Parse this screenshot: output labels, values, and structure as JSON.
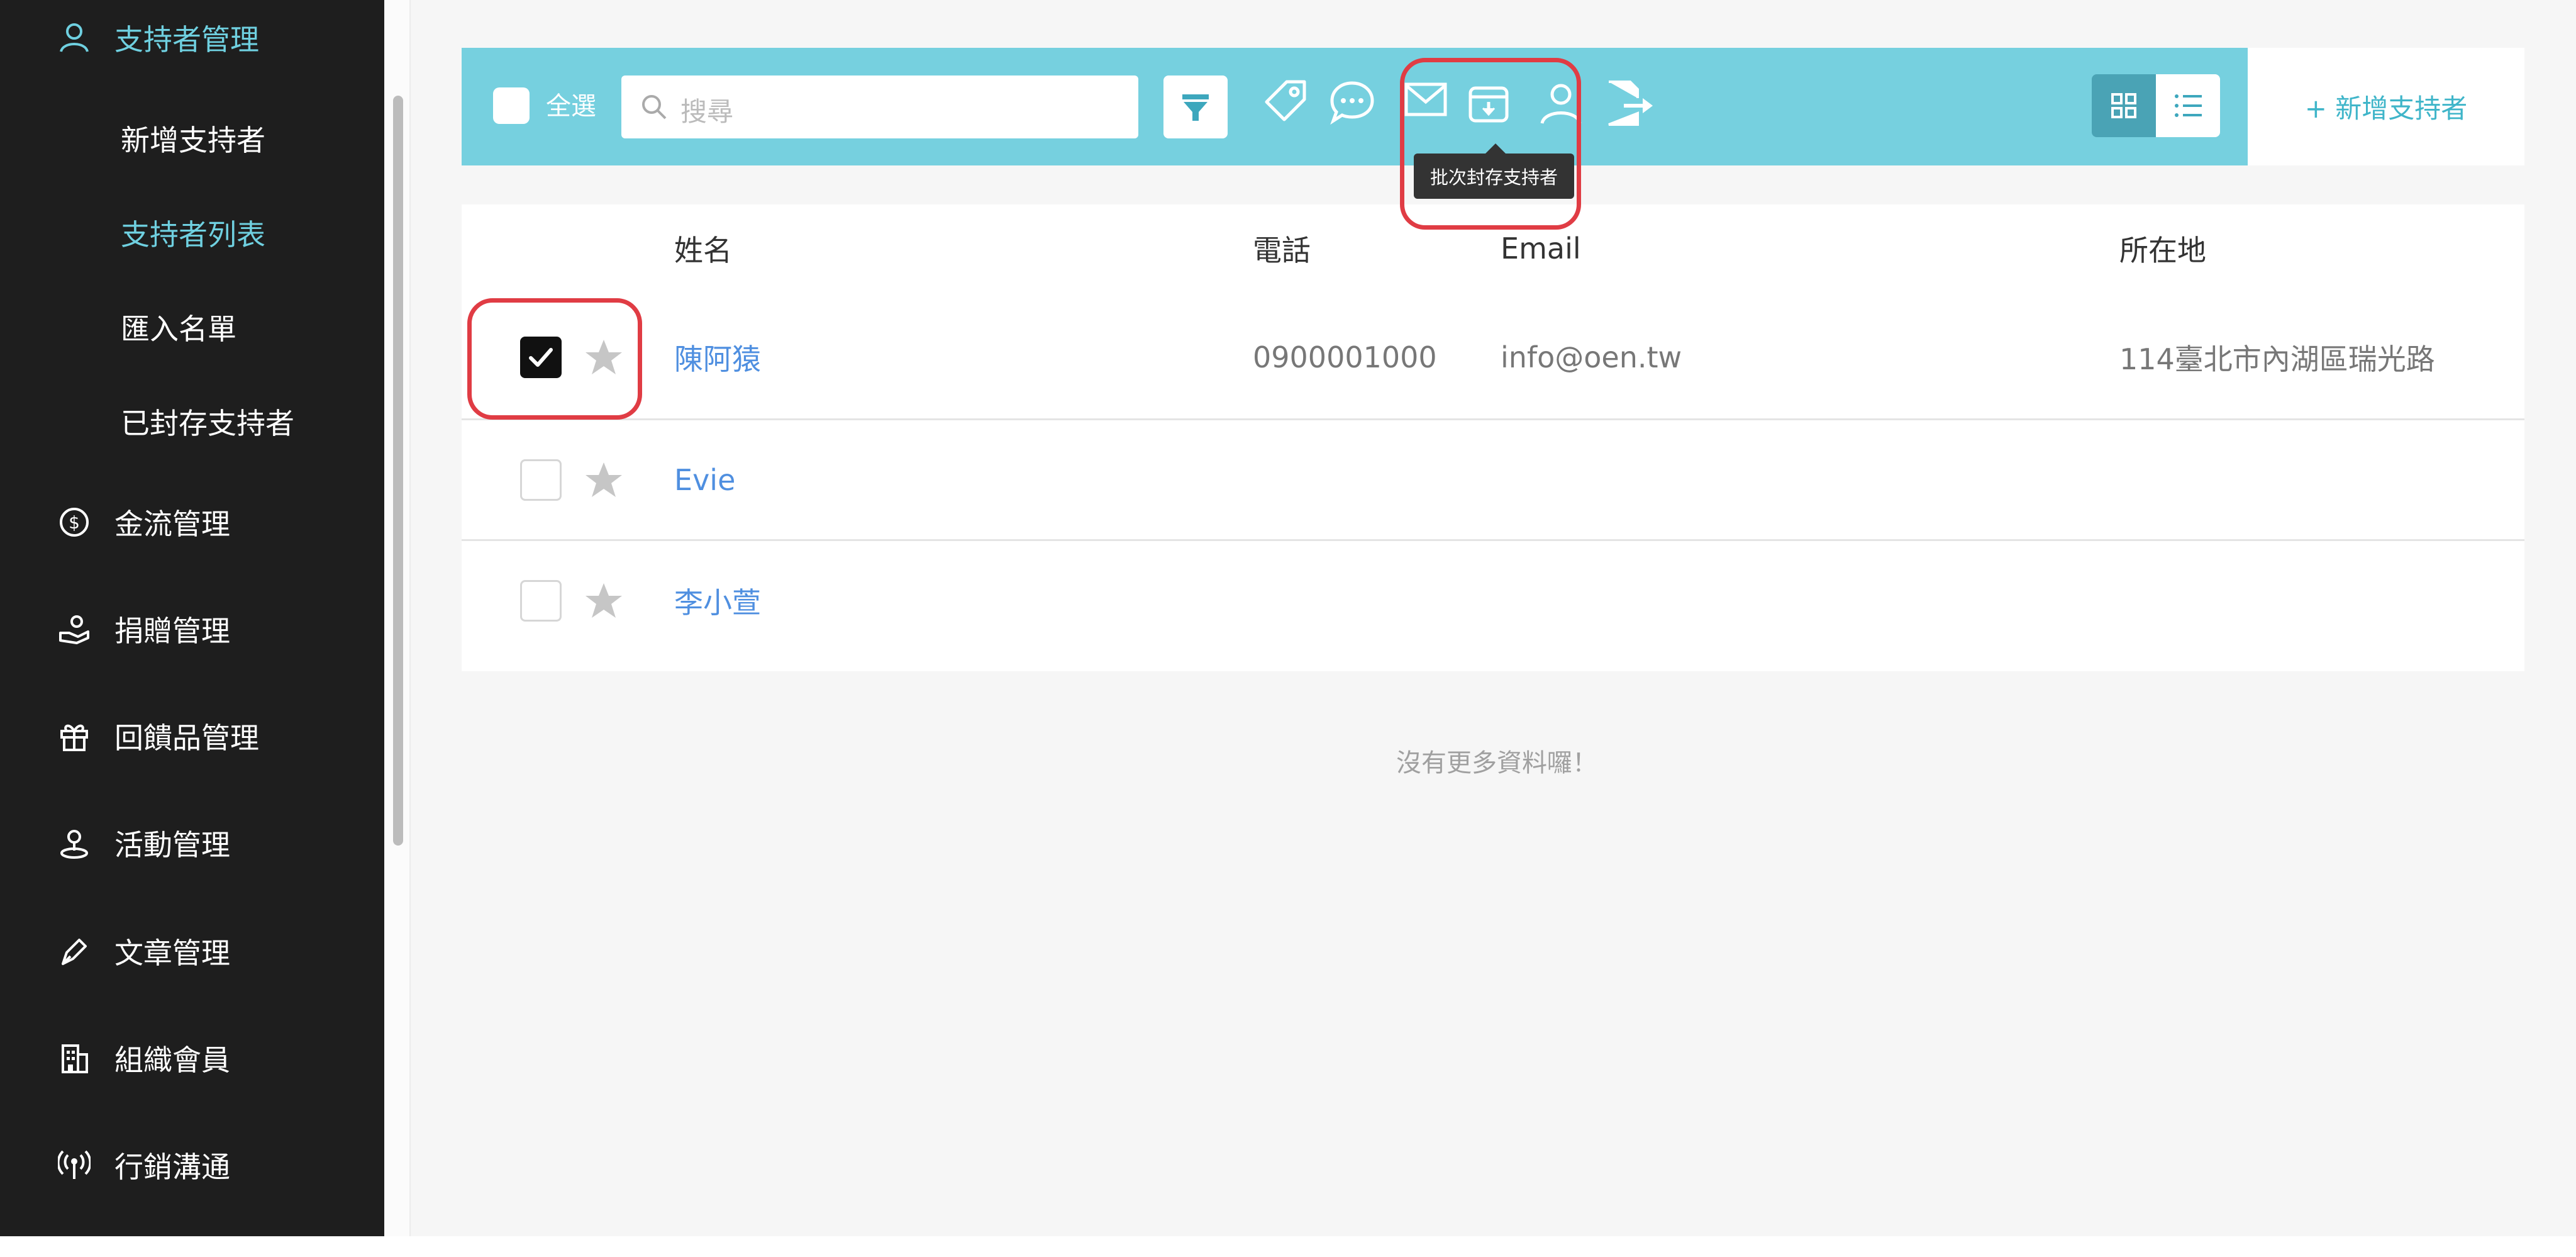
{
  "sidebar": {
    "items": [
      {
        "label": "支持者管理",
        "icon": "user-icon",
        "active": true
      },
      {
        "label": "新增支持者"
      },
      {
        "label": "支持者列表",
        "active": true
      },
      {
        "label": "匯入名單"
      },
      {
        "label": "已封存支持者"
      },
      {
        "label": "金流管理",
        "icon": "dollar-circle-icon"
      },
      {
        "label": "捐贈管理",
        "icon": "donation-hand-icon"
      },
      {
        "label": "回饋品管理",
        "icon": "gift-icon"
      },
      {
        "label": "活動管理",
        "icon": "location-pin-icon"
      },
      {
        "label": "文章管理",
        "icon": "pen-icon"
      },
      {
        "label": "組織會員",
        "icon": "building-icon"
      },
      {
        "label": "行銷溝通",
        "icon": "broadcast-icon"
      }
    ]
  },
  "toolbar": {
    "select_all_label": "全選",
    "search_placeholder": "搜尋",
    "tooltip": "批次封存支持者",
    "new_supporter_label": "+ 新增支持者"
  },
  "table": {
    "columns": [
      "姓名",
      "電話",
      "Email",
      "所在地"
    ],
    "rows": [
      {
        "name": "陳阿猿",
        "phone": "0900001000",
        "email": "info@oen.tw",
        "location": "114臺北市內湖區瑞光路",
        "checked": true
      },
      {
        "name": "Evie",
        "phone": "",
        "email": "",
        "location": "",
        "checked": false
      },
      {
        "name": "李小萱",
        "phone": "",
        "email": "",
        "location": "",
        "checked": false
      }
    ]
  },
  "empty_message": "沒有更多資料囉！",
  "colors": {
    "sidebar_bg": "#1e1e1e",
    "accent_cyan": "#76d0df",
    "name_link": "#4f8fe0",
    "highlight_red": "#e03c44"
  }
}
